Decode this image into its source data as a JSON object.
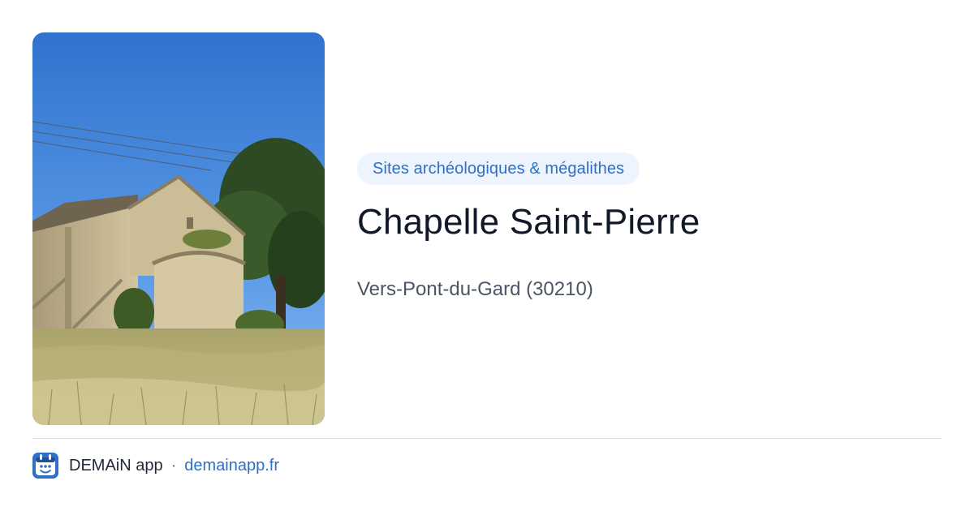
{
  "card": {
    "category": "Sites archéologiques & mégalithes",
    "title": "Chapelle Saint-Pierre",
    "location": "Vers-Pont-du-Gard (30210)"
  },
  "photo": {
    "subject": "chapel-photo"
  },
  "footer": {
    "app_name": "DEMAiN app",
    "separator": "·",
    "site": "demainapp.fr"
  },
  "colors": {
    "accent": "#2f6fc4",
    "pill_bg": "#eef4fd",
    "title": "#111827",
    "muted": "#4b5563",
    "divider": "#dbe4ea"
  }
}
